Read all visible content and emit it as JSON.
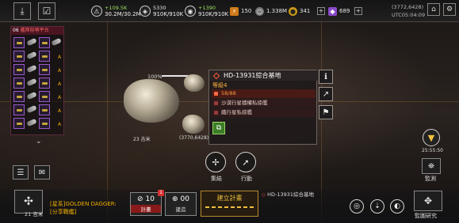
{
  "topbar": {
    "res1": {
      "gain": "+109.5K",
      "value": "30.2M/30.2M"
    },
    "res2": {
      "gain": "5330",
      "value": "910K/910K"
    },
    "res3": {
      "gain": "+1390",
      "value": "910K/910K"
    },
    "cur1": "150",
    "cur2": "1.338M",
    "cur3": "341",
    "cur4": "689",
    "coords": "(3772,6428)",
    "time": "UTC05:04:09"
  },
  "fleet": {
    "header": "06",
    "header_label": "艦隊前哨平台",
    "levels": [
      "A",
      "A",
      "A",
      "A",
      "A",
      "A",
      "A",
      "A"
    ]
  },
  "target": {
    "name": "HD-13931綜合基地",
    "level": "等級4",
    "hp": "58/88",
    "row1": "沙漠行星穩權私掠艦",
    "row2": "織行星私掠艦",
    "percent": "100%",
    "distance": "23 吉米",
    "coords": "(3770,6428)"
  },
  "actions": {
    "gather": "集結",
    "move": "行動"
  },
  "right": {
    "clock": "25:55:50",
    "monitor": "監測"
  },
  "bottom": {
    "distance": "21 吉米",
    "galaxy_label": "[星系]GOLDEN DAGGER:",
    "share_label": "[分享戰艦]",
    "plan_count": "10",
    "plan_label": "計畫",
    "plan_badge": "1",
    "build_count": "00",
    "build_label": "建造",
    "build_plan": "建立計畫",
    "target_tag": "HD-13931綜合基地",
    "research": "監圖研究"
  },
  "colors": {
    "accent_gold": "#f0c040",
    "hp_orange": "#ff9a40",
    "gain_green": "#9be35f",
    "alert_red": "#ff5a3a"
  }
}
